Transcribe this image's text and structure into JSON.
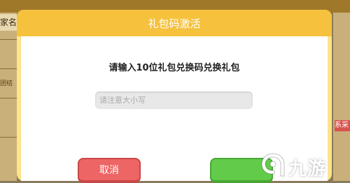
{
  "background": {
    "left_tab_text": "家名",
    "left_label_text": "团结",
    "right_badge_text": "系采"
  },
  "dialog": {
    "title": "礼包码激活",
    "prompt": "请输入10位礼包兑换码兑换礼包",
    "code_input": {
      "value": "",
      "placeholder": "请注意大小写"
    },
    "cancel_label": "取消",
    "confirm_label": ""
  },
  "watermark": {
    "text": "九游",
    "icon": "jiuyou-logo-icon"
  },
  "colors": {
    "header": "#f6c23e",
    "frame": "#fde38b",
    "cancel": "#ee6565",
    "confirm": "#62cc4a"
  }
}
